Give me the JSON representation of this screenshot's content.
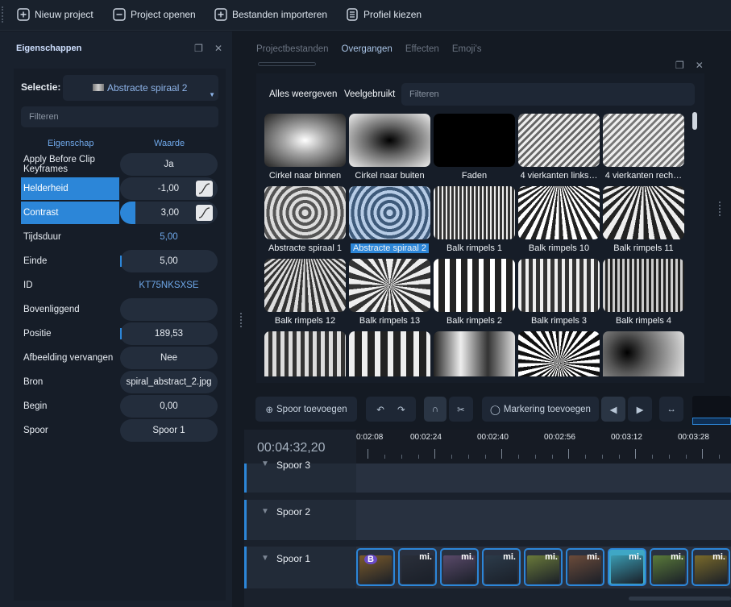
{
  "toolbar": {
    "new_project": "Nieuw project",
    "open_project": "Project openen",
    "import_files": "Bestanden importeren",
    "choose_profile": "Profiel kiezen"
  },
  "properties": {
    "title": "Eigenschappen",
    "selection_label": "Selectie:",
    "selection_value": "Abstracte spiraal 2",
    "filter_placeholder": "Filteren",
    "col_property": "Eigenschap",
    "col_value": "Waarde",
    "rows": [
      {
        "name": "Apply Before Clip Keyframes",
        "value": "Ja"
      },
      {
        "name": "Helderheid",
        "value": "-1,00"
      },
      {
        "name": "Contrast",
        "value": "3,00"
      },
      {
        "name": "Tijdsduur",
        "value": "5,00"
      },
      {
        "name": "Einde",
        "value": "5,00"
      },
      {
        "name": "ID",
        "value": "KT75NKSXSE"
      },
      {
        "name": "Bovenliggend",
        "value": ""
      },
      {
        "name": "Positie",
        "value": "189,53"
      },
      {
        "name": "Afbeelding vervangen",
        "value": "Nee"
      },
      {
        "name": "Bron",
        "value": "spiral_abstract_2.jpg"
      },
      {
        "name": "Begin",
        "value": "0,00"
      },
      {
        "name": "Spoor",
        "value": "Spoor 1"
      }
    ]
  },
  "browser": {
    "tabs": [
      "Projectbestanden",
      "Overgangen",
      "Effecten",
      "Emoji's"
    ],
    "active_tab": "Overgangen",
    "show_all": "Alles weergeven",
    "frequently_used": "Veelgebruikt",
    "filter_placeholder": "Filteren",
    "transitions": [
      "Cirkel naar binnen",
      "Cirkel naar buiten",
      "Faden",
      "4 vierkanten links…",
      "4 vierkanten rech…",
      "Abstracte spiraal 1",
      "Abstracte spiraal 2",
      "Balk rimpels 1",
      "Balk rimpels 10",
      "Balk rimpels 11",
      "Balk rimpels 12",
      "Balk rimpels 13",
      "Balk rimpels 2",
      "Balk rimpels 3",
      "Balk rimpels 4",
      "",
      "",
      "",
      "",
      ""
    ],
    "selected_transition": "Abstracte spiraal 2"
  },
  "timeline_toolbar": {
    "add_track": "Spoor toevoegen",
    "add_marker": "Markering toevoegen"
  },
  "timeline": {
    "timecode": "00:04:32,20",
    "ruler_labels": [
      "0:02:08",
      "00:02:24",
      "00:02:40",
      "00:02:56",
      "00:03:12",
      "00:03:28"
    ],
    "tracks": [
      "Spoor 3",
      "Spoor 2",
      "Spoor 1"
    ],
    "clip_titles": [
      "B",
      "mi.",
      "mi.",
      "mi.",
      "mi.",
      "mi.",
      "mi.",
      "mi.",
      "mi."
    ]
  },
  "colors": {
    "accent": "#2c86d8",
    "background": "#141a23",
    "panel": "#19212d"
  }
}
